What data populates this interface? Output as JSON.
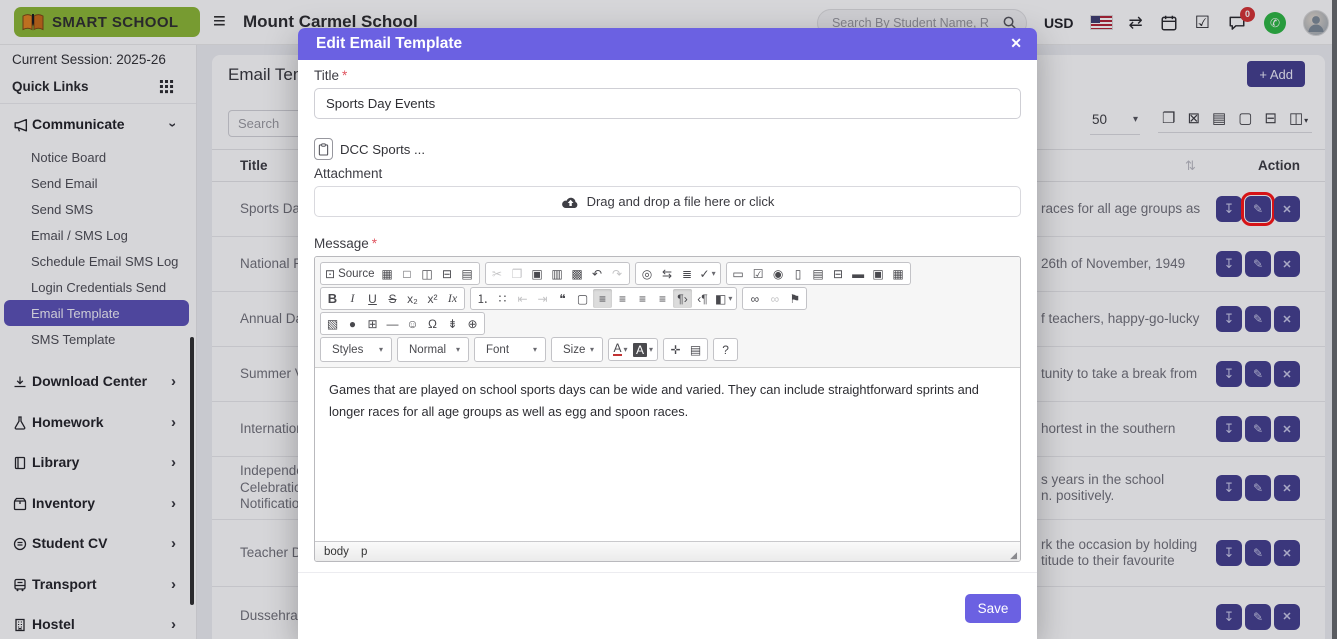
{
  "colors": {
    "accent": "#6b61e2",
    "indigo": "#423d8e",
    "active": "#5a50b6",
    "annot": "#ff1212",
    "badge": "#d63031",
    "wa": "#2bb741",
    "lgreen": "#8cb832"
  },
  "header": {
    "logo_text": "SMART SCHOOL",
    "school_name": "Mount Carmel School",
    "search_placeholder": "Search By Student Name, R",
    "currency": "USD",
    "chat_badge": "0",
    "burger_icon": "≡",
    "swap_icon": "⇄",
    "check_icon": "☑",
    "wa_icon": "✆"
  },
  "sidebar": {
    "session": "Current Session: 2025-26",
    "quick_links": "Quick Links",
    "menu": {
      "label": "Communicate",
      "caret": "›",
      "items": [
        {
          "label": "Notice Board",
          "name": "sidebar-item-notice-board"
        },
        {
          "label": "Send Email",
          "name": "sidebar-item-send-email"
        },
        {
          "label": "Send SMS",
          "name": "sidebar-item-send-sms"
        },
        {
          "label": "Email / SMS Log",
          "name": "sidebar-item-email-sms-log"
        },
        {
          "label": "Schedule Email SMS Log",
          "name": "sidebar-item-schedule-email-sms-log"
        },
        {
          "label": "Login Credentials Send",
          "name": "sidebar-item-login-credentials-send"
        },
        {
          "label": "Email Template",
          "name": "sidebar-item-email-template",
          "active": true
        },
        {
          "label": "SMS Template",
          "name": "sidebar-item-sms-template"
        }
      ]
    },
    "sections": [
      {
        "label": "Download Center"
      },
      {
        "label": "Homework"
      },
      {
        "label": "Library"
      },
      {
        "label": "Inventory"
      },
      {
        "label": "Student CV"
      },
      {
        "label": "Transport"
      },
      {
        "label": "Hostel"
      }
    ],
    "section_caret": "›"
  },
  "content": {
    "panel_title": "Email Tem",
    "add_button": "+ Add",
    "search_placeholder": "Search",
    "page_size": "50",
    "page_size_caret": "▾",
    "columns": {
      "title": "Title",
      "action": "Action"
    },
    "sort_icon": "⇅",
    "export_icons": [
      {
        "g": "❐",
        "n": "copy-export-icon"
      },
      {
        "g": "⊠",
        "n": "excel-export-icon"
      },
      {
        "g": "▤",
        "n": "csv-export-icon"
      },
      {
        "g": "▢",
        "n": "pdf-export-icon"
      },
      {
        "g": "⊟",
        "n": "print-export-icon"
      },
      {
        "g": "◫",
        "dd": "▾",
        "n": "column-visibility-icon"
      }
    ],
    "rows": [
      {
        "title": "Sports Day",
        "desc": "races for all age groups as",
        "hcls": "h55",
        "annotated": true
      },
      {
        "title": "National Re",
        "desc": "26th of November, 1949",
        "hcls": "h55"
      },
      {
        "title": "Annual Day",
        "desc": "f teachers, happy-go-lucky",
        "hcls": "h55"
      },
      {
        "title": "Summer Va",
        "desc": "tunity to take a break from",
        "hcls": "h55"
      },
      {
        "title": "Internationa",
        "desc": "hortest in the southern",
        "hcls": "h55"
      },
      {
        "title": "Independen\nCelebration\nNotification",
        "desc": "s years in the school\nn. positively.",
        "hcls": "h63"
      },
      {
        "title": "Teacher Da",
        "desc": "rk the occasion by holding\ntitude to their favourite",
        "hcls": "h67"
      },
      {
        "title": "Dussehra C",
        "desc": "",
        "hcls": "h60"
      }
    ]
  },
  "actions": {
    "download": "↧",
    "edit": "✎",
    "delete": "✕"
  },
  "modal": {
    "title": "Edit Email Template",
    "close_icon": "✕",
    "title_label": "Title",
    "required_mark": "*",
    "title_value": "Sports Day Events",
    "attachment_chip": "DCC Sports ...",
    "attachment_label": "Attachment",
    "dropzone_text": "Drag and drop a file here or click",
    "message_label": "Message",
    "save_label": "Save",
    "editor": {
      "body_text": "Games that are played on school sports days can be wide and varied. They can include straightforward sprints and longer races for all age groups as well as egg and spoon races.",
      "path_body": "body",
      "path_elem": "p",
      "resize_icon": "◢",
      "toolbar_rows": [
        {
          "groups": [
            {
              "btns": [
                {
                  "g": "⊡",
                  "t": "Source",
                  "n": "source-button"
                },
                {
                  "g": "▦",
                  "n": "save-button"
                },
                {
                  "g": "□",
                  "n": "new-page-button"
                },
                {
                  "g": "◫",
                  "n": "preview-button"
                },
                {
                  "g": "⊟",
                  "n": "print-button"
                },
                {
                  "g": "▤",
                  "n": "templates-button"
                }
              ]
            },
            {
              "btns": [
                {
                  "g": "✂",
                  "n": "cut-button",
                  "d": true
                },
                {
                  "g": "❐",
                  "n": "copy-button",
                  "d": true
                },
                {
                  "g": "▣",
                  "n": "paste-button"
                },
                {
                  "g": "▥",
                  "n": "paste-text-button"
                },
                {
                  "g": "▩",
                  "n": "paste-word-button"
                },
                {
                  "g": "↶",
                  "n": "undo-button"
                },
                {
                  "g": "↷",
                  "n": "redo-button",
                  "d": true
                }
              ]
            },
            {
              "btns": [
                {
                  "g": "◎",
                  "n": "find-button"
                },
                {
                  "g": "⇆",
                  "n": "replace-button"
                },
                {
                  "g": "≣",
                  "n": "select-all-button"
                },
                {
                  "g": "✓",
                  "dd": "▾",
                  "n": "spellcheck-button"
                }
              ]
            },
            {
              "btns": [
                {
                  "g": "▭",
                  "n": "form-button"
                },
                {
                  "g": "☑",
                  "n": "checkbox-button"
                },
                {
                  "g": "◉",
                  "n": "radio-button"
                },
                {
                  "g": "▯",
                  "n": "text-field-button"
                },
                {
                  "g": "▤",
                  "n": "textarea-button"
                },
                {
                  "g": "⊟",
                  "n": "select-field-button"
                },
                {
                  "g": "▬",
                  "n": "button-button"
                },
                {
                  "g": "▣",
                  "n": "image-button-button"
                },
                {
                  "g": "▦",
                  "n": "hidden-field-button"
                }
              ]
            }
          ]
        },
        {
          "groups": [
            {
              "btns": [
                {
                  "g": "B",
                  "cls": "fb",
                  "n": "bold-button"
                },
                {
                  "g": "I",
                  "cls": "fi",
                  "n": "italic-button"
                },
                {
                  "g": "U",
                  "cls": "fu",
                  "n": "underline-button"
                },
                {
                  "g": "S",
                  "cls": "fs",
                  "n": "strike-button"
                },
                {
                  "g": "x₂",
                  "n": "subscript-button"
                },
                {
                  "g": "x²",
                  "n": "superscript-button"
                },
                {
                  "g": "Ix",
                  "cls": "fi",
                  "n": "remove-format-button"
                }
              ]
            },
            {
              "btns": [
                {
                  "g": "⒈",
                  "n": "numbered-list-button"
                },
                {
                  "g": "∷",
                  "n": "bulleted-list-button"
                },
                {
                  "g": "⇤",
                  "d": true,
                  "n": "outdent-button"
                },
                {
                  "g": "⇥",
                  "d": true,
                  "n": "indent-button"
                },
                {
                  "g": "❝",
                  "n": "blockquote-button"
                },
                {
                  "g": "▢",
                  "n": "div-button"
                },
                {
                  "g": "≡",
                  "p": true,
                  "n": "align-left-button"
                },
                {
                  "g": "≡",
                  "n": "align-center-button"
                },
                {
                  "g": "≡",
                  "n": "align-right-button"
                },
                {
                  "g": "≡",
                  "n": "align-justify-button"
                },
                {
                  "g": "¶›",
                  "p": true,
                  "n": "bidi-ltr-button"
                },
                {
                  "g": "‹¶",
                  "n": "bidi-rtl-button"
                },
                {
                  "g": "◧",
                  "dd": "▾",
                  "n": "language-button"
                }
              ]
            },
            {
              "btns": [
                {
                  "g": "∞",
                  "n": "link-button"
                },
                {
                  "g": "∞",
                  "d": true,
                  "n": "unlink-button"
                },
                {
                  "g": "⚑",
                  "n": "anchor-button"
                }
              ]
            }
          ]
        },
        {
          "groups": [
            {
              "btns": [
                {
                  "g": "▧",
                  "n": "image-button"
                },
                {
                  "g": "●",
                  "n": "flash-button"
                },
                {
                  "g": "⊞",
                  "n": "table-button"
                },
                {
                  "g": "―",
                  "n": "horizontal-rule-button"
                },
                {
                  "g": "☺",
                  "n": "smiley-button"
                },
                {
                  "g": "Ω",
                  "n": "special-char-button"
                },
                {
                  "g": "⇟",
                  "n": "page-break-button"
                },
                {
                  "g": "⊕",
                  "n": "iframe-button"
                }
              ]
            }
          ]
        },
        {
          "groups": [
            {
              "btns": [
                {
                  "t": "Styles",
                  "dd": "▾",
                  "cls": "combo",
                  "n": "styles-dropdown"
                }
              ]
            },
            {
              "btns": [
                {
                  "t": "Normal",
                  "dd": "▾",
                  "cls": "combo",
                  "n": "format-dropdown"
                }
              ]
            },
            {
              "btns": [
                {
                  "t": "Font",
                  "dd": "▾",
                  "cls": "combo",
                  "n": "font-dropdown"
                }
              ]
            },
            {
              "btns": [
                {
                  "t": "Size",
                  "dd": "▾",
                  "cls": "combo-sm",
                  "n": "size-dropdown"
                }
              ]
            },
            {
              "btns": [
                {
                  "g": "A",
                  "dd": "▾",
                  "cls": "txtcol",
                  "n": "text-color-button"
                },
                {
                  "g": "A",
                  "dd": "▾",
                  "cls": "bgcol",
                  "n": "bg-color-button"
                }
              ]
            },
            {
              "btns": [
                {
                  "g": "✛",
                  "n": "maximize-button"
                },
                {
                  "g": "▤",
                  "n": "show-blocks-button"
                }
              ]
            },
            {
              "btns": [
                {
                  "g": "?",
                  "n": "about-button"
                }
              ]
            }
          ]
        }
      ]
    }
  }
}
